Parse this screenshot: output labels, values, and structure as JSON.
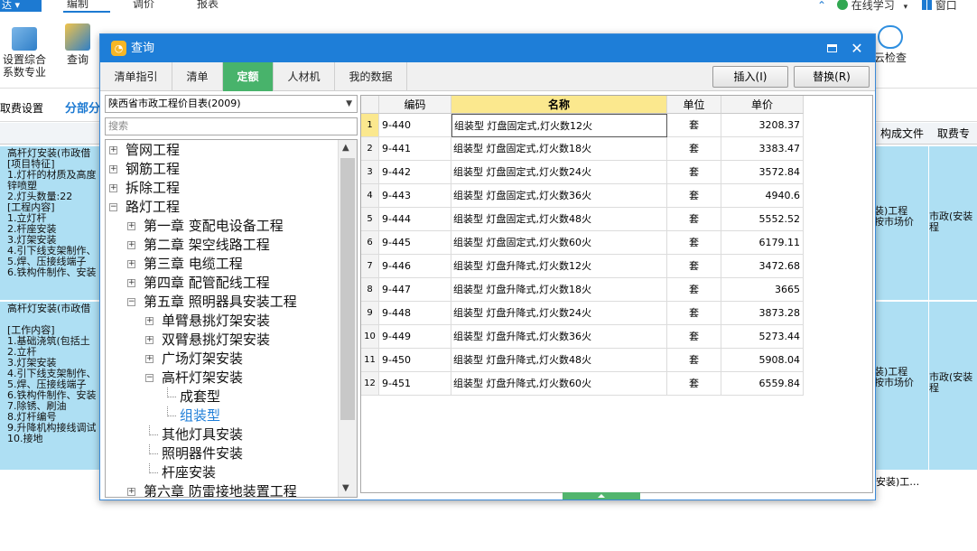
{
  "topbar": {
    "app_badge": "达 ▾",
    "tabs": [
      "编制",
      "调价",
      "报表"
    ],
    "right_items": [
      "⌃",
      "在线学习",
      "▾",
      "窗口"
    ]
  },
  "ribbon": {
    "left_buttons": [
      "设置综合\n系数专业",
      "查询"
    ],
    "right_buttons": [
      "云检查"
    ]
  },
  "subbar": {
    "items": [
      "取费设置",
      "分部分"
    ]
  },
  "bg_grid": {
    "right_headers": [
      "构成文件",
      "取费专"
    ],
    "left_blocks": [
      "高杆灯安装(市政借\n[项目特征]\n1.灯杆的材质及高度\n锌喷塑\n2.灯头数量:22\n[工程内容]\n1.立灯杆\n2.杆座安装\n3.灯架安装\n4.引下线支架制作、\n5.焊、压接线端子\n6.铁构件制作、安装",
      "高杆灯安装(市政借\n\n[工作内容]\n1.基础浇筑(包括土\n2.立杆\n3.灯架安装\n4.引下线支架制作、\n5.焊、压接线端子\n6.铁构件制作、安装\n7.除锈、刷油\n8.灯杆编号\n9.升降机构接线调试\n10.接地"
    ],
    "right_blocks": [
      {
        "a": "装)工程\n按市场价",
        "b": "市政(安装\n程"
      },
      {
        "a": "装)工程\n按市场价",
        "b": "市政(安装\n程"
      }
    ],
    "bottom_text": "安装)工…"
  },
  "dialog": {
    "title": "查询",
    "logo": "◔",
    "tabs": [
      "清单指引",
      "清单",
      "定额",
      "人材机",
      "我的数据"
    ],
    "active_tab": 2,
    "insert_button": "插入(I)",
    "replace_button": "替换(R)",
    "library_select": "陕西省市政工程价目表(2009)",
    "search_placeholder": "搜索"
  },
  "tree": [
    {
      "label": "管网工程",
      "level": 0,
      "exp": "+"
    },
    {
      "label": "钢筋工程",
      "level": 0,
      "exp": "+"
    },
    {
      "label": "拆除工程",
      "level": 0,
      "exp": "+"
    },
    {
      "label": "路灯工程",
      "level": 0,
      "exp": "-"
    },
    {
      "label": "第一章 变配电设备工程",
      "level": 1,
      "exp": "+"
    },
    {
      "label": "第二章 架空线路工程",
      "level": 1,
      "exp": "+"
    },
    {
      "label": "第三章 电缆工程",
      "level": 1,
      "exp": "+"
    },
    {
      "label": "第四章 配管配线工程",
      "level": 1,
      "exp": "+"
    },
    {
      "label": "第五章 照明器具安装工程",
      "level": 1,
      "exp": "-"
    },
    {
      "label": "单臂悬挑灯架安装",
      "level": 2,
      "exp": "+"
    },
    {
      "label": "双臂悬挑灯架安装",
      "level": 2,
      "exp": "+"
    },
    {
      "label": "广场灯架安装",
      "level": 2,
      "exp": "+"
    },
    {
      "label": "高杆灯架安装",
      "level": 2,
      "exp": "-"
    },
    {
      "label": "成套型",
      "level": 3,
      "exp": ""
    },
    {
      "label": "组装型",
      "level": 3,
      "exp": "",
      "selected": true
    },
    {
      "label": "其他灯具安装",
      "level": 2,
      "exp": ""
    },
    {
      "label": "照明器件安装",
      "level": 2,
      "exp": ""
    },
    {
      "label": "杆座安装",
      "level": 2,
      "exp": ""
    },
    {
      "label": "第六章 防雷接地装置工程",
      "level": 1,
      "exp": "+"
    }
  ],
  "grid": {
    "headers": [
      "编码",
      "名称",
      "单位",
      "单价"
    ],
    "current_row": 1,
    "rows": [
      {
        "n": "1",
        "code": "9-440",
        "name": "组装型 灯盘固定式,灯火数12火",
        "unit": "套",
        "price": "3208.37"
      },
      {
        "n": "2",
        "code": "9-441",
        "name": "组装型 灯盘固定式,灯火数18火",
        "unit": "套",
        "price": "3383.47"
      },
      {
        "n": "3",
        "code": "9-442",
        "name": "组装型 灯盘固定式,灯火数24火",
        "unit": "套",
        "price": "3572.84"
      },
      {
        "n": "4",
        "code": "9-443",
        "name": "组装型 灯盘固定式,灯火数36火",
        "unit": "套",
        "price": "4940.6"
      },
      {
        "n": "5",
        "code": "9-444",
        "name": "组装型 灯盘固定式,灯火数48火",
        "unit": "套",
        "price": "5552.52"
      },
      {
        "n": "6",
        "code": "9-445",
        "name": "组装型 灯盘固定式,灯火数60火",
        "unit": "套",
        "price": "6179.11"
      },
      {
        "n": "7",
        "code": "9-446",
        "name": "组装型 灯盘升降式,灯火数12火",
        "unit": "套",
        "price": "3472.68"
      },
      {
        "n": "8",
        "code": "9-447",
        "name": "组装型 灯盘升降式,灯火数18火",
        "unit": "套",
        "price": "3665"
      },
      {
        "n": "9",
        "code": "9-448",
        "name": "组装型 灯盘升降式,灯火数24火",
        "unit": "套",
        "price": "3873.28"
      },
      {
        "n": "10",
        "code": "9-449",
        "name": "组装型 灯盘升降式,灯火数36火",
        "unit": "套",
        "price": "5273.44"
      },
      {
        "n": "11",
        "code": "9-450",
        "name": "组装型 灯盘升降式,灯火数48火",
        "unit": "套",
        "price": "5908.04"
      },
      {
        "n": "12",
        "code": "9-451",
        "name": "组装型 灯盘升降式,灯火数60火",
        "unit": "套",
        "price": "6559.84"
      }
    ]
  }
}
